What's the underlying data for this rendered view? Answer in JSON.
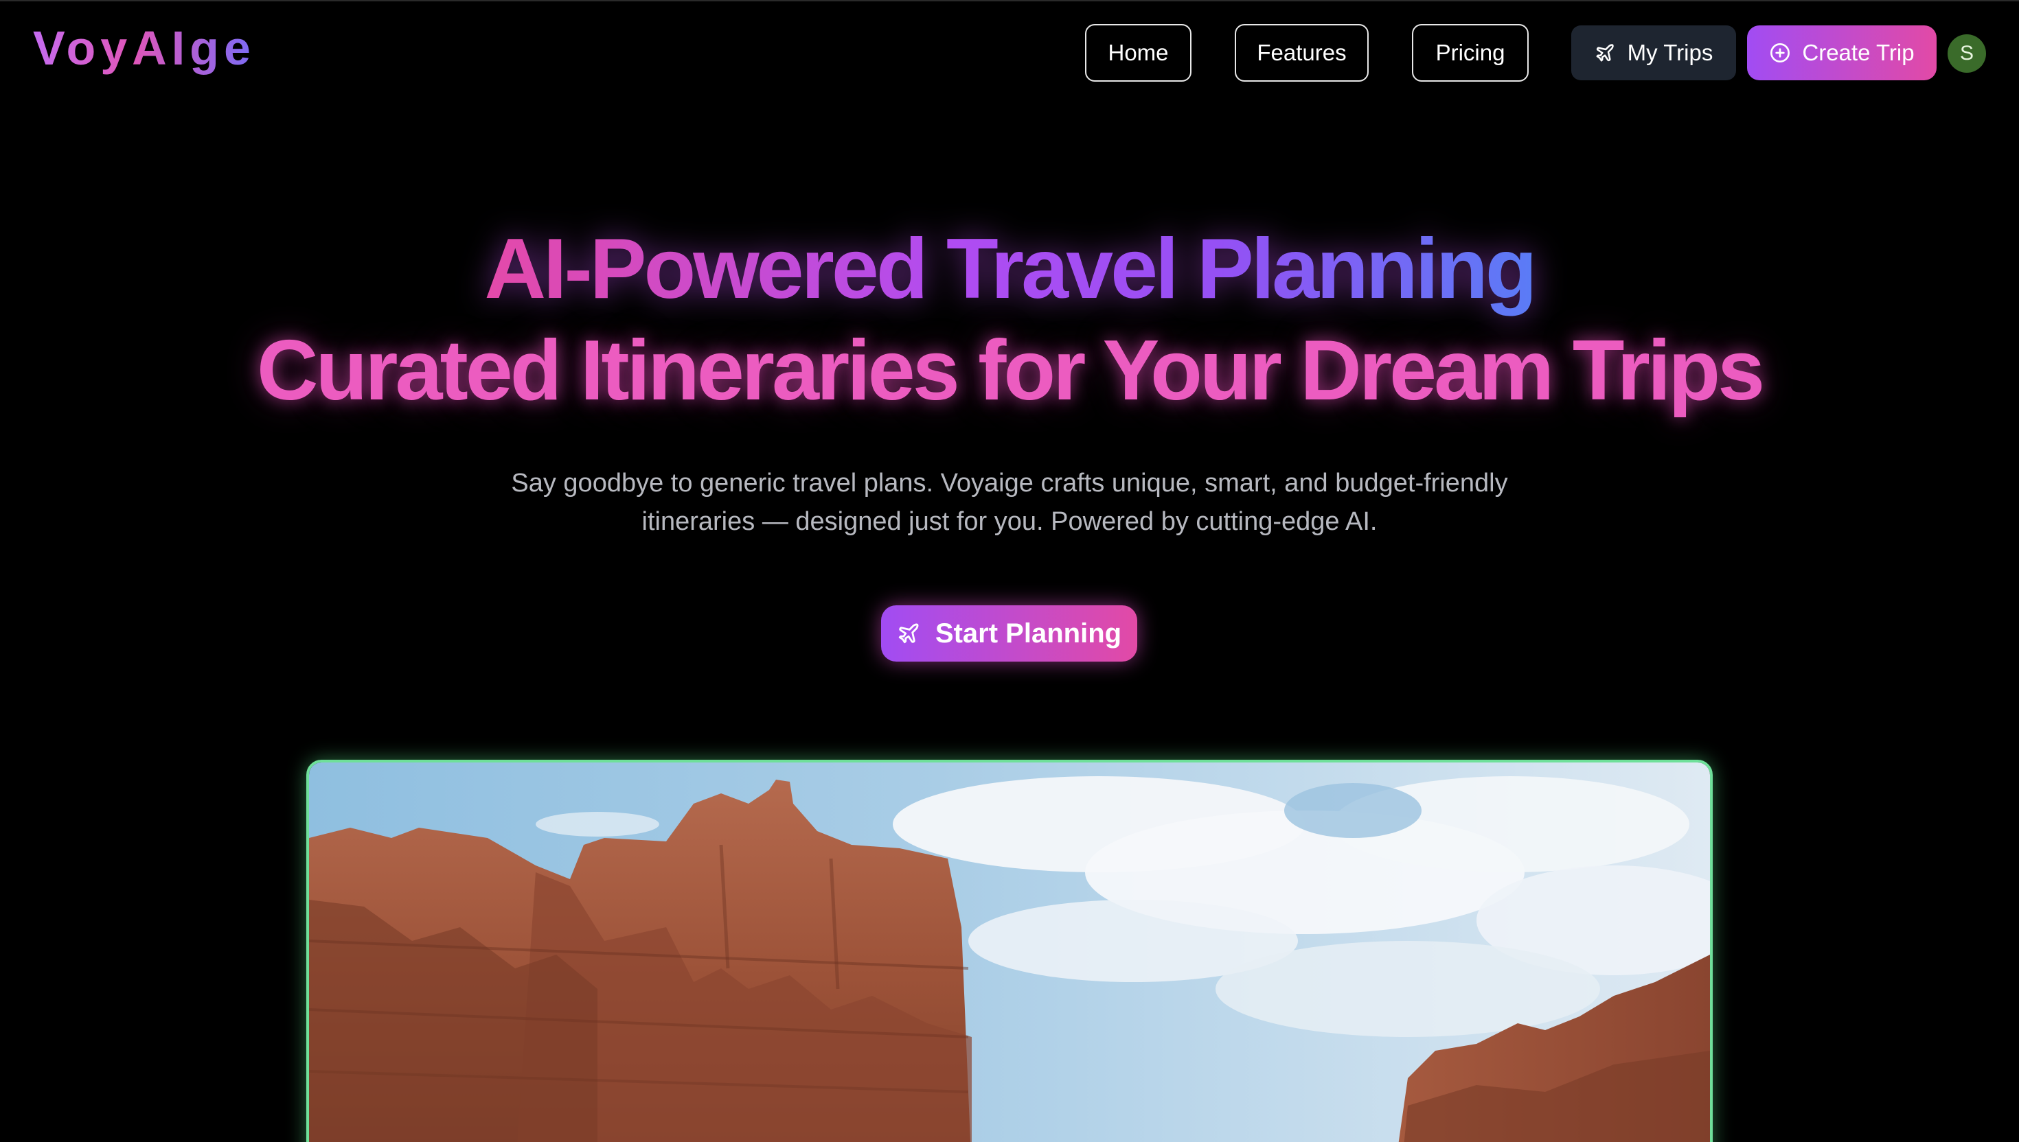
{
  "nav": {
    "logo": "VoyAIge",
    "links": [
      {
        "label": "Home"
      },
      {
        "label": "Features"
      },
      {
        "label": "Pricing"
      }
    ],
    "my_trips": {
      "label": "My Trips",
      "icon": "plane-icon"
    },
    "create_trip": {
      "label": "Create Trip",
      "icon": "plus-circle-icon"
    },
    "avatar_initial": "S"
  },
  "hero": {
    "title_line1": "AI-Powered Travel Planning",
    "title_line2": "Curated Itineraries for Your Dream Trips",
    "subtitle_line1": "Say goodbye to generic travel plans. Voyaige crafts unique, smart, and budget-friendly",
    "subtitle_line2": "itineraries — designed just for you. Powered by cutting-edge AI.",
    "cta": {
      "label": "Start Planning",
      "icon": "plane-icon"
    }
  },
  "showcase": {
    "image_subject": "red-rock-canyon-landscape"
  },
  "colors": {
    "background": "#000000",
    "brand_purple": "#a14cf3",
    "brand_pink": "#e24aa6",
    "frame_glow": "#6fe09a",
    "avatar": "#3a6b2a",
    "my_trips_bg": "#1e2530"
  }
}
